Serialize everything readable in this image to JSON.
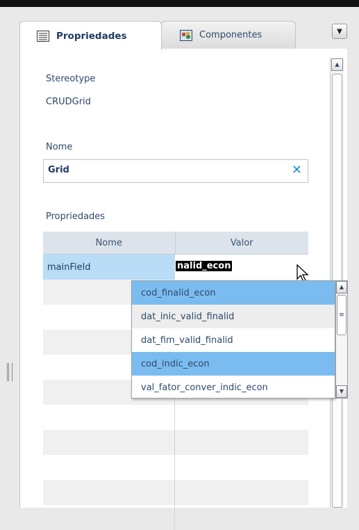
{
  "tabs": [
    {
      "label": "Propriedades",
      "icon": "properties-list-icon",
      "active": true
    },
    {
      "label": "Componentes",
      "icon": "components-icon",
      "active": false
    }
  ],
  "stereotype": {
    "label": "Stereotype",
    "value": "CRUDGrid"
  },
  "nome": {
    "label": "Nome",
    "value": "Grid",
    "clear_icon": "✕"
  },
  "propriedades": {
    "label": "Propriedades",
    "columns": [
      "Nome",
      "Valor"
    ],
    "rows": [
      {
        "nome": "mainField",
        "valor": "nalid_econ"
      }
    ]
  },
  "dropdown": {
    "options": [
      "cod_finalid_econ",
      "dat_inic_valid_finalid",
      "dat_fim_valid_finalid",
      "cod_indic_econ",
      "val_fator_conver_indic_econ"
    ],
    "highlighted": [
      "cod_finalid_econ",
      "cod_indic_econ"
    ]
  },
  "colors": {
    "accent": "#1a8fd8",
    "selection": "#7bbcf0",
    "row_selected": "#b9dcf7"
  }
}
